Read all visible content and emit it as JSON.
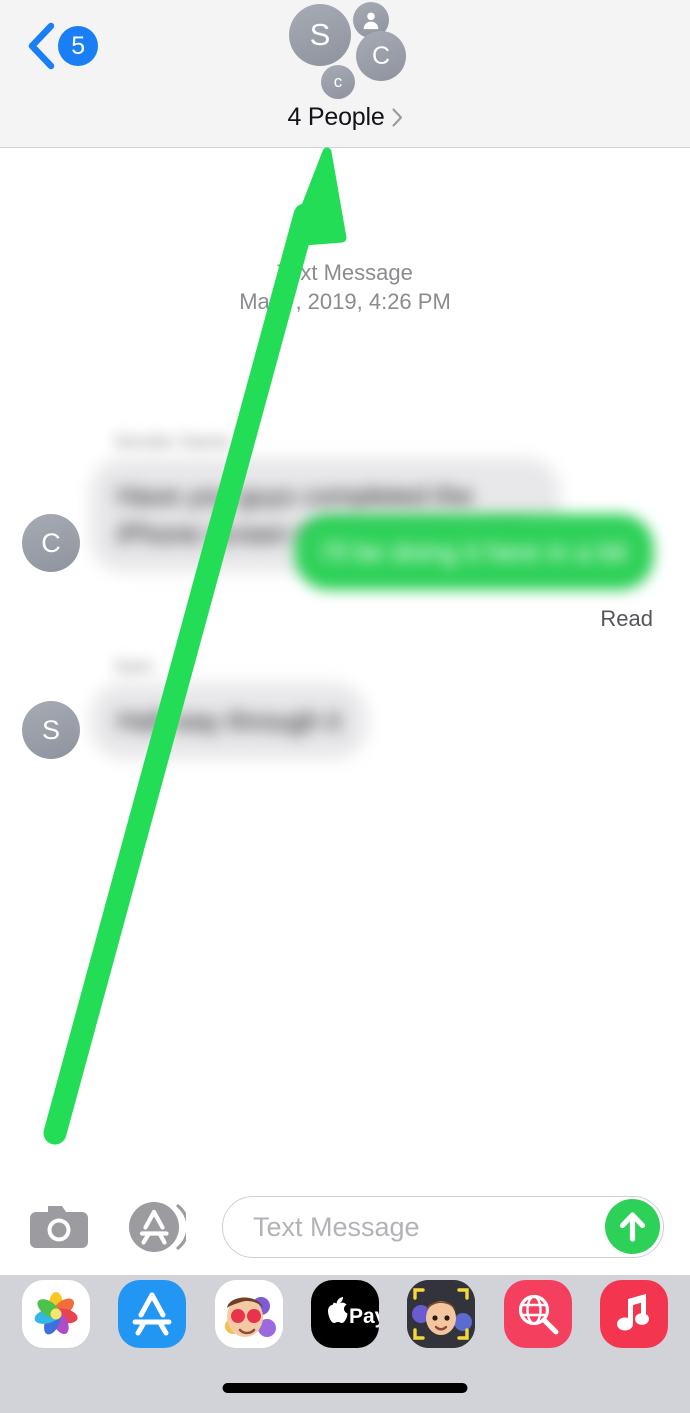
{
  "header": {
    "back": {
      "icon": "chevron-left-icon",
      "badge": "5"
    },
    "avatars": [
      {
        "name": "avatar-s",
        "initial": "S"
      },
      {
        "name": "avatar-person",
        "initial": ""
      },
      {
        "name": "avatar-c-large",
        "initial": "C"
      },
      {
        "name": "avatar-c-small",
        "initial": "c"
      }
    ],
    "title": "4 People",
    "title_chevron": "chevron-right-icon"
  },
  "thread": {
    "timestamp_kind": "Text Message",
    "timestamp_when": "Mar 7, 2019, 4:26 PM",
    "messages": [
      {
        "name": "message-incoming-1",
        "avatar_initial": "C",
        "sender": "Sender Name",
        "text": "Have you guys completed the iPhone screen repair training yet?",
        "direction": "incoming"
      },
      {
        "name": "message-outgoing-1",
        "text": "I'll be doing it here in a bit",
        "direction": "outgoing",
        "receipt": "Read"
      },
      {
        "name": "message-incoming-2",
        "avatar_initial": "S",
        "sender": "Sam",
        "text": "Half way through it",
        "direction": "incoming"
      }
    ]
  },
  "annotation": {
    "name": "green-arrow-annotation",
    "color": "#22dd55",
    "points_to": "4 People"
  },
  "input_bar": {
    "camera_icon": "camera-icon",
    "appstore_icon": "app-store-icon",
    "placeholder": "Text Message",
    "value": "",
    "send_icon": "arrow-up-icon",
    "send_color": "#2ed158"
  },
  "app_drawer": {
    "apps": [
      {
        "name": "app-photos",
        "label": "Photos"
      },
      {
        "name": "app-store",
        "label": "App Store"
      },
      {
        "name": "app-memoji-stickers",
        "label": "Memoji Stickers"
      },
      {
        "name": "app-apple-pay",
        "label": "Apple Pay"
      },
      {
        "name": "app-animoji",
        "label": "Animoji"
      },
      {
        "name": "app-images",
        "label": "#images"
      },
      {
        "name": "app-apple-music",
        "label": "Apple Music"
      }
    ]
  },
  "colors": {
    "header_bg": "#f4f4f5",
    "accent_blue": "#1a7ef5",
    "bubble_in": "#e8e8ea",
    "bubble_out": "#2ed158",
    "drawer_bg": "#d2d3d8"
  }
}
